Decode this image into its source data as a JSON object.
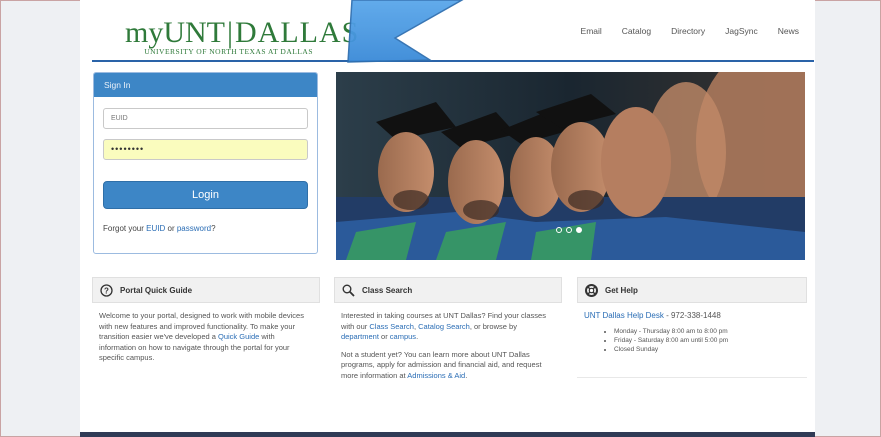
{
  "header": {
    "logo_my": "myUNT",
    "logo_dallas": "DALLAS",
    "logo_sub": "UNIVERSITY OF NORTH TEXAS AT DALLAS",
    "nav": [
      "Email",
      "Catalog",
      "Directory",
      "JagSync",
      "News"
    ]
  },
  "signin": {
    "title": "Sign In",
    "euid_placeholder": "EUID",
    "password_value": "••••••••",
    "login_label": "Login",
    "forgot_prefix": "Forgot your ",
    "forgot_euid": "EUID",
    "forgot_or": " or ",
    "forgot_password": "password",
    "forgot_suffix": "?"
  },
  "hero": {
    "slides": 3,
    "active_slide": 3
  },
  "panels": {
    "quick_guide": {
      "title": "Portal Quick Guide",
      "text1": "Welcome to your portal, designed to work with mobile devices with new features and improved functionality. To make your transition easier we've developed a ",
      "link": "Quick Guide",
      "text2": " with information on how to navigate through the portal for your specific campus."
    },
    "class_search": {
      "title": "Class Search",
      "p1_a": "Interested in taking courses at UNT Dallas? Find your classes with our ",
      "p1_link1": "Class Search",
      "p1_b": ", ",
      "p1_link2": "Catalog Search",
      "p1_c": ", or browse by ",
      "p1_link3": "department",
      "p1_d": " or ",
      "p1_link4": "campus",
      "p1_e": ".",
      "p2_a": "Not a student yet? You can learn more about UNT Dallas programs, apply for admission and financial aid, and request more information at ",
      "p2_link": "Admissions & Aid",
      "p2_b": "."
    },
    "get_help": {
      "title": "Get Help",
      "desk_link": "UNT Dallas Help Desk",
      "phone": " - 972-338-1448",
      "hours": [
        "Monday - Thursday 8:00 am to 8:00 pm",
        "Friday - Saturday 8:00 am until 5:00 pm",
        "Closed Sunday"
      ]
    }
  },
  "colors": {
    "brand_green": "#2f7a3a",
    "accent_blue": "#3d86c6",
    "link_blue": "#2a6db5"
  }
}
